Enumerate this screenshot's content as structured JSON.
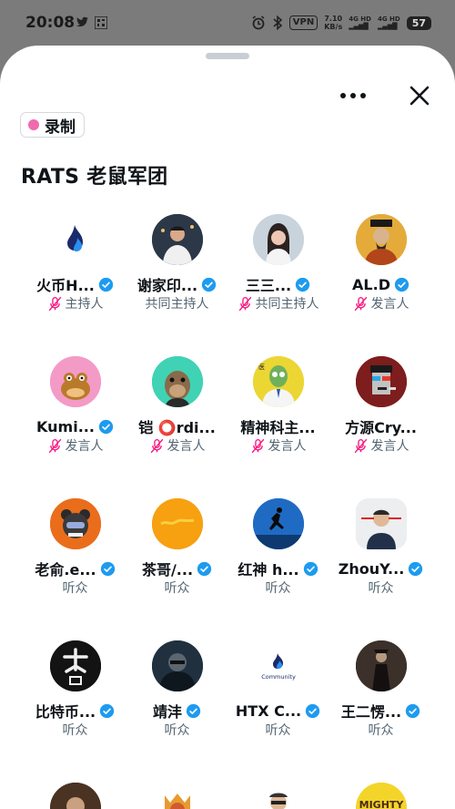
{
  "status_bar": {
    "time": "20:08",
    "vpn": "VPN",
    "speed_value": "7.10",
    "speed_unit": "KB/s",
    "signal_1": "4G HD",
    "signal_2": "4G HD",
    "battery": "57"
  },
  "sheet": {
    "recording_label": "录制",
    "title": "RATS 老鼠军团"
  },
  "colors": {
    "verified_blue": "#1d9bf0",
    "muted_mic": "#f91880",
    "record_dot": "#f06ab0"
  },
  "participants": [
    {
      "name": "火币H...",
      "role": "主持人",
      "verified": true,
      "muted": true,
      "avatar_icon": "huobi-flame-icon"
    },
    {
      "name": "谢家印...",
      "role": "共同主持人",
      "verified": true,
      "muted": false,
      "avatar_icon": "man-photo"
    },
    {
      "name": "三三...",
      "role": "共同主持人",
      "verified": true,
      "muted": true,
      "avatar_icon": "woman-photo"
    },
    {
      "name": "AL.D",
      "role": "发言人",
      "verified": true,
      "muted": true,
      "avatar_icon": "emperor-painting"
    },
    {
      "name": "Kumi...",
      "role": "发言人",
      "verified": true,
      "muted": true,
      "avatar_icon": "cartoon-frog"
    },
    {
      "name": "铠 ⭕rdi...",
      "role": "发言人",
      "verified": false,
      "muted": true,
      "avatar_icon": "bored-ape"
    },
    {
      "name": "精神科主...",
      "role": "发言人",
      "verified": false,
      "muted": true,
      "avatar_icon": "zombie-doctor"
    },
    {
      "name": "方源Cry...",
      "role": "发言人",
      "verified": false,
      "muted": true,
      "avatar_icon": "pixel-punk"
    },
    {
      "name": "老俞.e...",
      "role": "听众",
      "verified": true,
      "muted": false,
      "avatar_icon": "bear-astronaut"
    },
    {
      "name": "茶哥/...",
      "role": "听众",
      "verified": true,
      "muted": false,
      "avatar_icon": "orange-logo"
    },
    {
      "name": "红神 h...",
      "role": "听众",
      "verified": true,
      "muted": false,
      "avatar_icon": "jumper-silhouette"
    },
    {
      "name": "ZhouY...",
      "role": "听众",
      "verified": true,
      "muted": false,
      "avatar_icon": "laser-eye-man"
    },
    {
      "name": "比特币...",
      "role": "听众",
      "verified": true,
      "muted": false,
      "avatar_icon": "dark-calligraphy"
    },
    {
      "name": "靖沣",
      "role": "听众",
      "verified": true,
      "muted": false,
      "avatar_icon": "man-glasses-photo"
    },
    {
      "name": "HTX C...",
      "role": "听众",
      "verified": true,
      "muted": false,
      "avatar_icon": "htx-community-logo"
    },
    {
      "name": "王二愣...",
      "role": "听众",
      "verified": true,
      "muted": false,
      "avatar_icon": "dark-figure-photo"
    }
  ],
  "partial_row_text": {
    "mighty": "MIGHTY"
  }
}
